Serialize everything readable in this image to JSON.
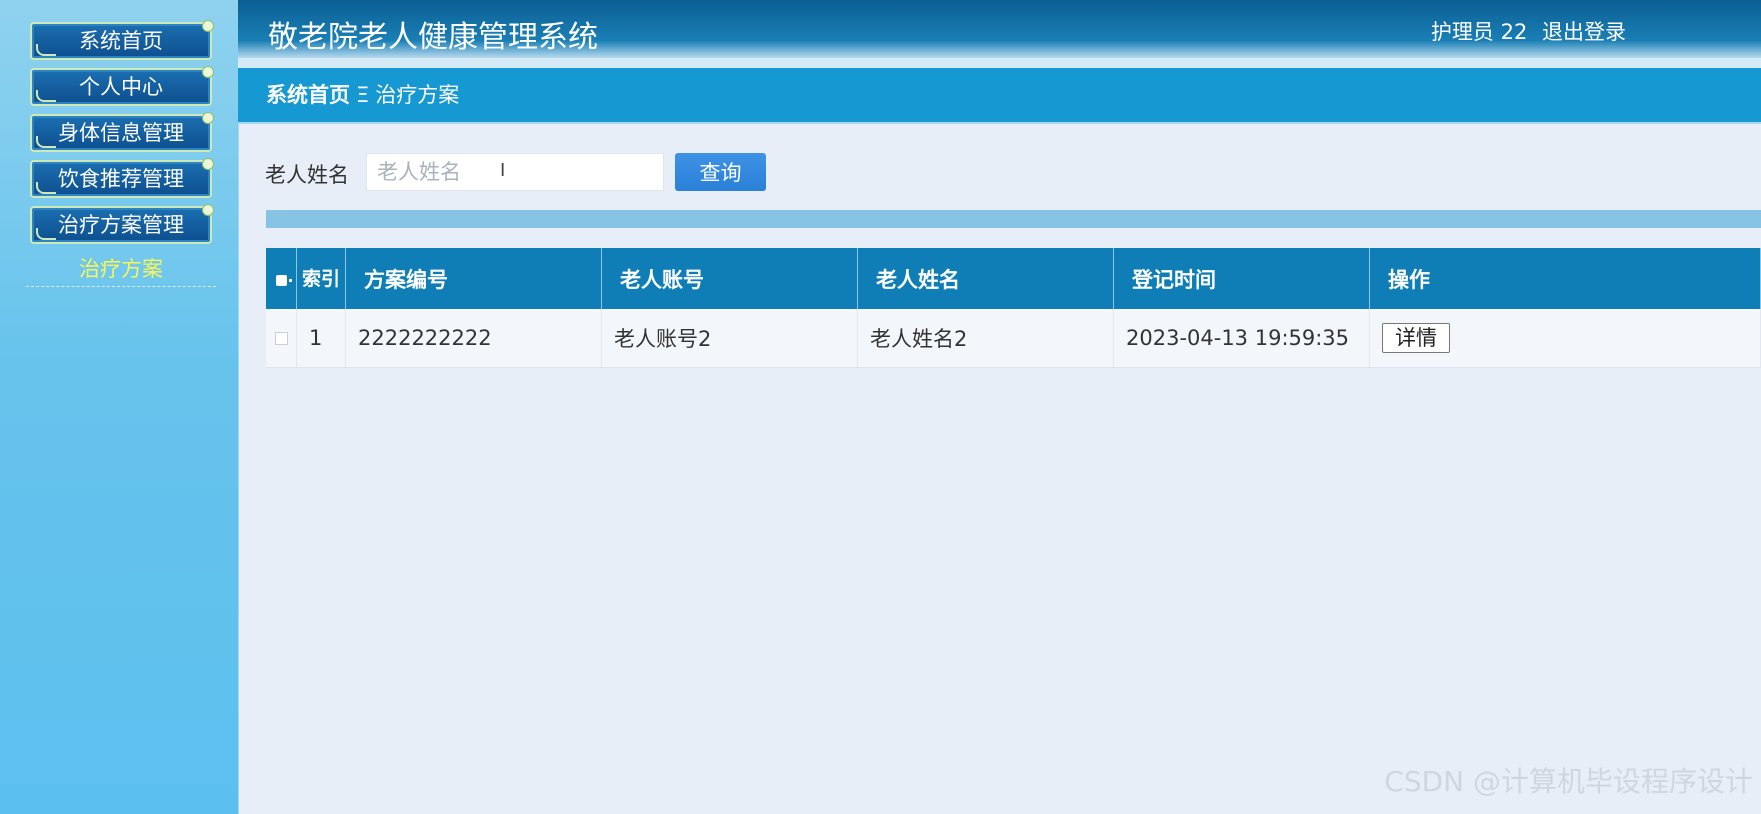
{
  "sidebar": {
    "items": [
      {
        "label": "系统首页"
      },
      {
        "label": "个人中心"
      },
      {
        "label": "身体信息管理"
      },
      {
        "label": "饮食推荐管理"
      },
      {
        "label": "治疗方案管理"
      }
    ],
    "active_sub": "治疗方案"
  },
  "header": {
    "title": "敬老院老人健康管理系统",
    "user": "护理员 22",
    "logout": "退出登录"
  },
  "breadcrumb": {
    "home": "系统首页",
    "separator": "Ξ",
    "current": "治疗方案"
  },
  "search": {
    "label": "老人姓名",
    "placeholder": "老人姓名",
    "value": "",
    "button": "查询"
  },
  "table": {
    "headers": {
      "index": "索引",
      "plan_no": "方案编号",
      "account": "老人账号",
      "name": "老人姓名",
      "time": "登记时间",
      "action": "操作"
    },
    "rows": [
      {
        "index": "1",
        "plan_no": "2222222222",
        "account": "老人账号2",
        "name": "老人姓名2",
        "time": "2023-04-13 19:59:35",
        "action": "详情"
      }
    ]
  },
  "watermark": "CSDN @计算机毕设程序设计",
  "colors": {
    "header": "#0a5f93",
    "breadcrumb_bar": "#1699d3",
    "table_header": "#0f7eb7",
    "sidebar": "#66c3ec",
    "active_sub": "#f7f65a",
    "search_button": "#2a7fd7"
  }
}
